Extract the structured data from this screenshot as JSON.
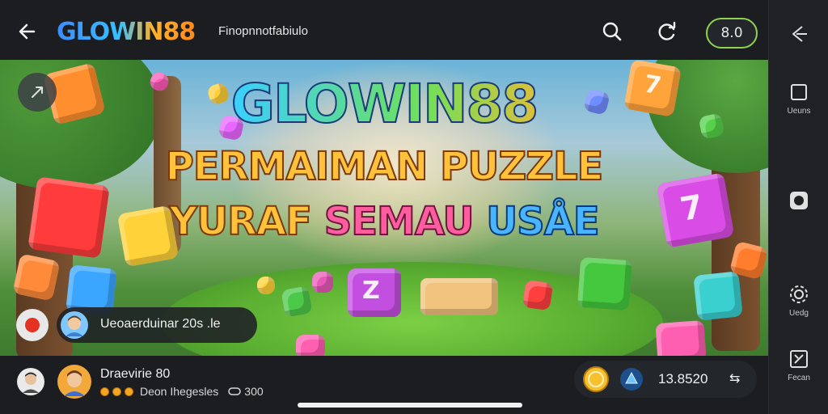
{
  "header": {
    "brand": "GLOWIN88",
    "subtitle": "Finopnnotfabiulo",
    "score": "8.0"
  },
  "icons": {
    "back": "back-arrow-icon",
    "search": "search-icon",
    "refresh": "refresh-icon",
    "share": "share-icon",
    "send": "send-icon"
  },
  "right_rail": {
    "items": [
      {
        "label": "",
        "icon": "share-icon"
      },
      {
        "label": "Ueuns",
        "icon": "square-icon"
      },
      {
        "label": "",
        "icon": "record-icon"
      },
      {
        "label": "Uedg",
        "icon": "gear-icon"
      },
      {
        "label": "Fecan",
        "icon": "close-box-icon"
      }
    ]
  },
  "banner": {
    "title": "GLOWIN88",
    "line1": "PERMAIMAN PUZZLE",
    "line2_word1": "YURAF",
    "line2_word2": "SEMAU",
    "line2_word3": "USÅE",
    "cube_labels": [
      "7",
      "Z",
      "7"
    ]
  },
  "live": {
    "user_text": "Ueoaerduinar 20s .le"
  },
  "footer": {
    "name": "Draevirie 80",
    "meta_text": "Deon Ihegesles",
    "meta_count": "300",
    "balance": "13.8520",
    "swap_symbol": "⇆"
  },
  "colors": {
    "accent_green": "#8ed34e",
    "record_red": "#e53122",
    "background": "#1b1d21"
  }
}
